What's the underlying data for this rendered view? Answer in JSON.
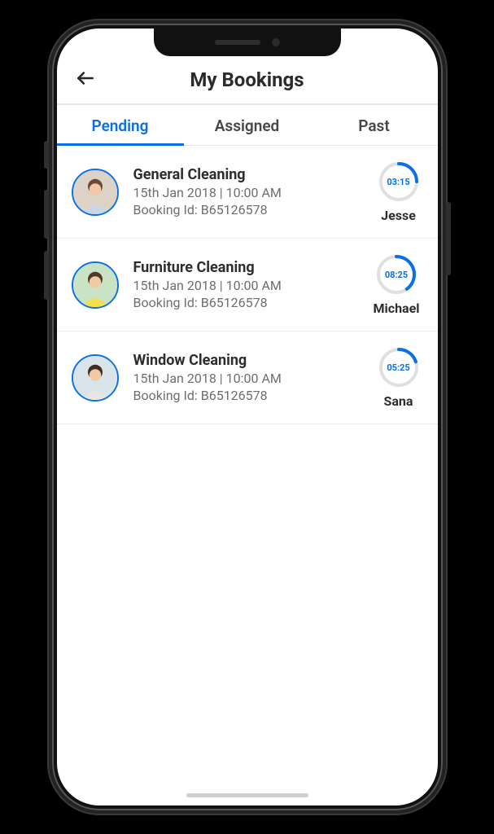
{
  "header": {
    "title": "My Bookings"
  },
  "tabs": [
    {
      "label": "Pending",
      "active": true
    },
    {
      "label": "Assigned",
      "active": false
    },
    {
      "label": "Past",
      "active": false
    }
  ],
  "bookingIdLabelPrefix": "Booking Id: ",
  "bookings": [
    {
      "service": "General Cleaning",
      "datetime": "15th Jan 2018 | 10:00 AM",
      "bookingId": "B65126578",
      "timer": "03:15",
      "provider": "Jesse",
      "progressPct": 25,
      "avatarColors": {
        "bg": "#dcd2c6",
        "shirt": "#c7d7e7",
        "hair": "#6d4a36"
      }
    },
    {
      "service": "Furniture Cleaning",
      "datetime": "15th Jan 2018 | 10:00 AM",
      "bookingId": "B65126578",
      "timer": "08:25",
      "provider": "Michael",
      "progressPct": 40,
      "avatarColors": {
        "bg": "#c9e3c4",
        "shirt": "#f4e04f",
        "hair": "#4f3a28"
      }
    },
    {
      "service": "Window Cleaning",
      "datetime": "15th Jan 2018 | 10:00 AM",
      "bookingId": "B65126578",
      "timer": "05:25",
      "provider": "Sana",
      "progressPct": 20,
      "avatarColors": {
        "bg": "#d8e4ea",
        "shirt": "#e9e5df",
        "hair": "#3d2f24"
      }
    }
  ],
  "colors": {
    "accent": "#0b6fe6",
    "textPrimary": "#2d2d2d",
    "textSecondary": "#6e6e6e",
    "divider": "#ececee"
  }
}
